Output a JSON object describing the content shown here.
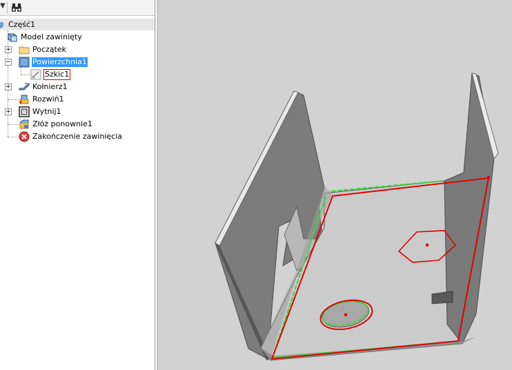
{
  "browser": {
    "toolbar": {
      "menu_caret": "▼",
      "find_icon": "binoculars-icon"
    },
    "root": {
      "label": "Część1",
      "icon": "part-icon"
    },
    "items": [
      {
        "label": "Model zawinięty",
        "icon": "folded-model-icon",
        "expander": "",
        "state": "normal"
      },
      {
        "label": "Początek",
        "icon": "folder-icon",
        "expander": "+",
        "state": "normal"
      },
      {
        "label": "Powierzchnia1",
        "icon": "face-icon",
        "expander": "−",
        "state": "selected"
      },
      {
        "label": "Szkic1",
        "icon": "sketch-icon",
        "expander": "",
        "state": "boxed"
      },
      {
        "label": "Kołnierz1",
        "icon": "flange-icon",
        "expander": "+",
        "state": "normal"
      },
      {
        "label": "Rozwiń1",
        "icon": "unfold-icon",
        "expander": "",
        "state": "normal"
      },
      {
        "label": "Wytnij1",
        "icon": "cut-icon",
        "expander": "+",
        "state": "normal"
      },
      {
        "label": "Złóż ponownie1",
        "icon": "refold-icon",
        "expander": "",
        "state": "normal"
      },
      {
        "label": "Zakończenie zawinięcia",
        "icon": "end-of-folded-icon",
        "expander": "",
        "state": "normal"
      }
    ]
  },
  "viewport": {
    "model": "sheet-metal-bracket",
    "colors": {
      "background": "#d2d2d2",
      "wall": "#7a7a7a",
      "base": "#c9c9c9",
      "sketch": "#e00000",
      "edge_highlight": "#33dd33"
    }
  }
}
